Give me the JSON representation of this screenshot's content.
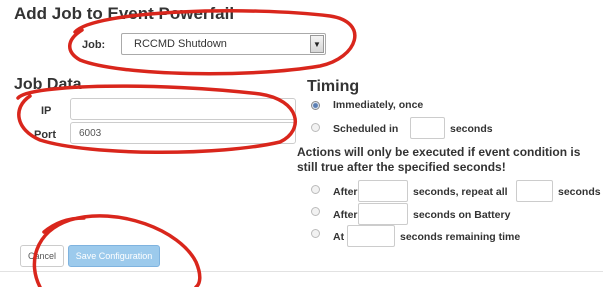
{
  "dialog": {
    "title": "Add Job to Event Powerfail",
    "job_label": "Job:",
    "job_value": "RCCMD Shutdown"
  },
  "job_data": {
    "heading": "Job Data",
    "ip_label": "IP",
    "ip_value": "",
    "port_label": "Port",
    "port_value": "6003"
  },
  "timing": {
    "heading": "Timing",
    "opt_immediately": "Immediately, once",
    "opt_scheduled": "Scheduled in",
    "seconds": "seconds",
    "note": "Actions will only be executed if event condition is still true after the specified seconds!",
    "opt_after": "After",
    "repeat_all": "seconds, repeat all",
    "seconds_on_battery": "seconds on Battery",
    "opt_at": "At",
    "remaining": "seconds remaining time",
    "selected": "immediately"
  },
  "footer": {
    "cancel_label": "Cancel",
    "save_label": "Save Configuration"
  },
  "colors": {
    "annotation_red": "#d9261c",
    "save_button": "#9ccaec"
  }
}
